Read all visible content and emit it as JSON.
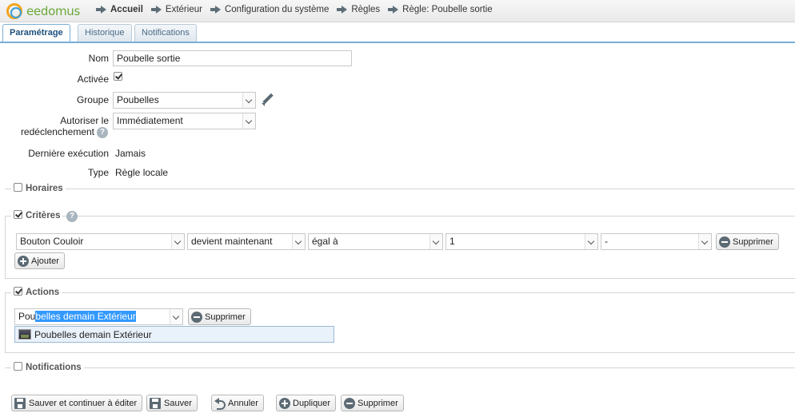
{
  "app": {
    "logo_text": "eedomus"
  },
  "breadcrumb": [
    "Accueil",
    "Extérieur",
    "Configuration du système",
    "Règles",
    "Règle: Poubelle sortie"
  ],
  "tabs": [
    "Paramétrage",
    "Historique",
    "Notifications"
  ],
  "form": {
    "nom_label": "Nom",
    "nom_value": "Poubelle sortie",
    "activee_label": "Activée",
    "activee_checked": true,
    "groupe_label": "Groupe",
    "groupe_value": "Poubelles",
    "autoriser_label_1": "Autoriser le",
    "autoriser_label_2": "redéclenchement",
    "autoriser_value": "Immédiatement",
    "derniere_label": "Dernière exécution",
    "derniere_value": "Jamais",
    "type_label": "Type",
    "type_value": "Règle locale"
  },
  "horaires": {
    "label": "Horaires",
    "checked": false
  },
  "criteres": {
    "label": "Critères",
    "checked": true,
    "row": {
      "device": "Bouton Couloir",
      "condition": "devient maintenant",
      "operator": "égal à",
      "value": "1",
      "extra": "-",
      "remove_label": "Supprimer"
    },
    "add_label": "Ajouter"
  },
  "actions": {
    "label": "Actions",
    "checked": true,
    "input_typed": "Pou",
    "input_selected": "belles demain Extérieur",
    "remove_label": "Supprimer",
    "suggestion": "Poubelles demain Extérieur"
  },
  "notifications": {
    "label": "Notifications",
    "checked": false
  },
  "footer": {
    "save_continue": "Sauver et continuer à éditer",
    "save": "Sauver",
    "cancel": "Annuler",
    "duplicate": "Dupliquer",
    "delete": "Supprimer"
  }
}
